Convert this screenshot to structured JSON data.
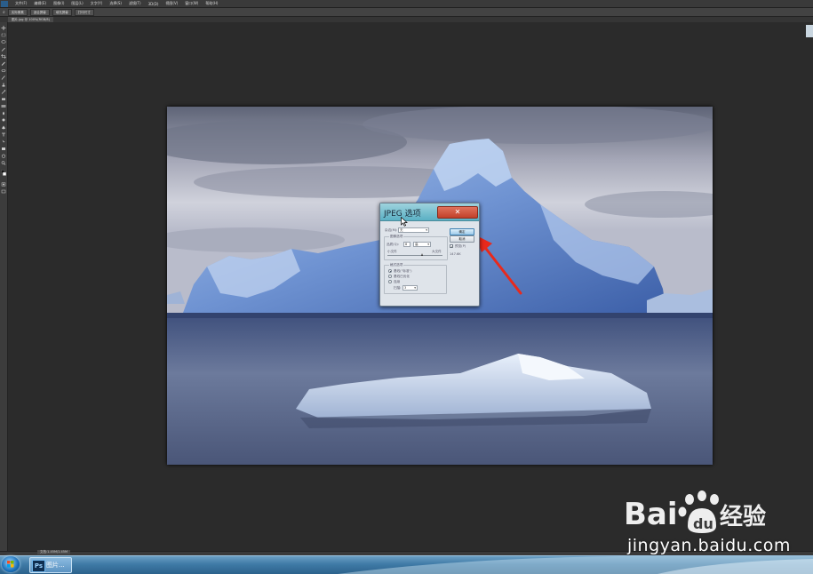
{
  "menubar": {
    "items": [
      "文件(F)",
      "编辑(E)",
      "图像(I)",
      "图层(L)",
      "文字(Y)",
      "选择(S)",
      "滤镜(T)",
      "3D(D)",
      "视图(V)",
      "窗口(W)",
      "帮助(H)"
    ]
  },
  "optbar": {
    "buttons": [
      "实际像素",
      "适合屏幕",
      "填充屏幕",
      "打印尺寸"
    ]
  },
  "document": {
    "tab_label": "图片.jpg @ 100%(RGB/8)"
  },
  "status": {
    "text": "文档:1.45M/1.45M"
  },
  "dialog": {
    "title": "JPEG 选项",
    "close_glyph": "✕",
    "matte_label": "杂边(M):",
    "matte_value": "无",
    "image_options_label": "图像选项",
    "quality_label": "品质(Q):",
    "quality_value": "8",
    "quality_setting": "高",
    "small_file_label": "小文件",
    "large_file_label": "大文件",
    "ok_label": "确定",
    "cancel_label": "取消",
    "preview_label": "预览(P)",
    "preview_checked": true,
    "size_readout": "147.6K",
    "format_options_label": "格式选项",
    "format_radios": [
      "基线(\"标准\")",
      "基线已优化",
      "连续"
    ],
    "format_selected": 0,
    "scans_label": "扫描:",
    "scans_value": "3"
  },
  "taskbar": {
    "ps_icon_text": "Ps",
    "task_label": "图片..."
  },
  "watermark": {
    "brand": "Baidu经验",
    "url": "jingyan.baidu.com"
  },
  "colors": {
    "workspace": "#2b2b2b",
    "dialog_titlebar": "#5ab0c4",
    "close_button": "#c2412a",
    "annotation_arrow": "#e8291c"
  }
}
